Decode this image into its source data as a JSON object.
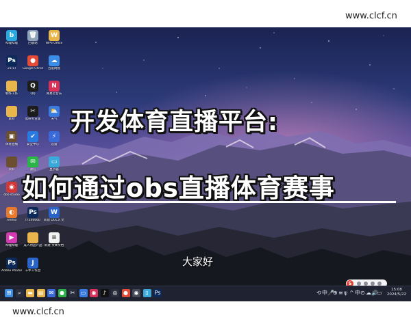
{
  "watermark": {
    "top": "www.clcf.cn",
    "bottom": "www.clcf.cn"
  },
  "overlay": {
    "title_line1": "开发体育直播平台:",
    "title_line2": "如何通过obs直播体育赛事",
    "subtitle": "大家好"
  },
  "desktop_icons": [
    {
      "label": "哔哩哔哩",
      "glyph": "b",
      "color": "#2aa9e0",
      "icon": "bilibili-icon"
    },
    {
      "label": "回收站",
      "glyph": "🗑",
      "color": "#8fa3b8",
      "icon": "recycle-bin-icon"
    },
    {
      "label": "WPS Office",
      "glyph": "W",
      "color": "#e8b64a",
      "icon": "folder-icon"
    },
    {
      "label": "21(1)",
      "glyph": "Ps",
      "color": "#0b2a5a",
      "icon": "photoshop-icon"
    },
    {
      "label": "Google Chrome",
      "glyph": "●",
      "color": "#e04b3a",
      "icon": "chrome-icon"
    },
    {
      "label": "百度网盘",
      "glyph": "☁",
      "color": "#3a8ee8",
      "icon": "cloud-icon"
    },
    {
      "label": "制作工作",
      "glyph": "",
      "color": "#e8b64a",
      "icon": "folder-icon"
    },
    {
      "label": "QQ",
      "glyph": "Q",
      "color": "#1d1d1d",
      "icon": "qq-icon"
    },
    {
      "label": "网易云音乐",
      "glyph": "N",
      "color": "#d8325a",
      "icon": "music-icon"
    },
    {
      "label": "素材",
      "glyph": "",
      "color": "#e8b64a",
      "icon": "folder-icon"
    },
    {
      "label": "剪映专业版",
      "glyph": "✂",
      "color": "#1c1c1c",
      "icon": "capcut-icon"
    },
    {
      "label": "天气",
      "glyph": "⛅",
      "color": "#3a7be0",
      "icon": "weather-icon"
    },
    {
      "label": "体育直播",
      "glyph": "▣",
      "color": "#6a5030",
      "icon": "image-icon"
    },
    {
      "label": "安全中心",
      "glyph": "✔",
      "color": "#2a7ae0",
      "icon": "shield-icon"
    },
    {
      "label": "迅雷",
      "glyph": "⚡",
      "color": "#3a6ad8",
      "icon": "thunder-icon"
    },
    {
      "label": "资料",
      "glyph": "",
      "color": "#6a5030",
      "icon": "folder-icon"
    },
    {
      "label": "微信",
      "glyph": "✉",
      "color": "#2bb34a",
      "icon": "wechat-icon"
    },
    {
      "label": "显示器",
      "glyph": "▭",
      "color": "#3aa8d8",
      "icon": "monitor-icon"
    },
    {
      "label": "obs-studio",
      "glyph": "◉",
      "color": "#d03838",
      "icon": "obs-icon"
    },
    {
      "label": "直播伴侣",
      "glyph": "◎",
      "color": "#e03a3a",
      "icon": "live-icon"
    },
    {
      "label": "抖音",
      "glyph": "♪",
      "color": "#111111",
      "icon": "douyin-icon"
    },
    {
      "label": "Firefox",
      "glyph": "◐",
      "color": "#e8782a",
      "icon": "firefox-icon"
    },
    {
      "label": "f7246660",
      "glyph": "Ps",
      "color": "#0b2a5a",
      "icon": "photoshop-icon"
    },
    {
      "label": "新建 DOCX 文档",
      "glyph": "W",
      "color": "#2a64c8",
      "icon": "word-icon"
    },
    {
      "label": "哔哩哔哩",
      "glyph": "▶",
      "color": "#d43ab0",
      "icon": "video-icon"
    },
    {
      "label": "成人用品产品",
      "glyph": "",
      "color": "#e8b64a",
      "icon": "folder-icon"
    },
    {
      "label": "新建 文本文档",
      "glyph": "≡",
      "color": "#f2f2f2",
      "icon": "text-file-icon"
    },
    {
      "label": "Adobe Photosho...",
      "glyph": "Ps",
      "color": "#0b2a5a",
      "icon": "photoshop-icon"
    },
    {
      "label": "千牛工作台",
      "glyph": "J",
      "color": "#2a64c8",
      "icon": "qianniu-icon"
    }
  ],
  "taskbar": {
    "apps": [
      {
        "name": "start-button",
        "glyph": "⊞",
        "color": "#3b8de0"
      },
      {
        "name": "search-icon",
        "glyph": "⌕",
        "color": "#2a2e3c"
      },
      {
        "name": "file-explorer-icon",
        "glyph": "▬",
        "color": "#e8b64a"
      },
      {
        "name": "file-explorer-icon",
        "glyph": "▤",
        "color": "#e8b64a"
      },
      {
        "name": "mail-icon",
        "glyph": "✉",
        "color": "#3a6ad8"
      },
      {
        "name": "wechat-icon",
        "glyph": "●",
        "color": "#2bb34a"
      },
      {
        "name": "capcut-icon",
        "glyph": "✂",
        "color": "#2a2e3c"
      },
      {
        "name": "app-icon",
        "glyph": "▭",
        "color": "#3a7be0"
      },
      {
        "name": "music-icon",
        "glyph": "◉",
        "color": "#d8325a"
      },
      {
        "name": "douyin-icon",
        "glyph": "♪",
        "color": "#111111"
      },
      {
        "name": "obs-icon",
        "glyph": "◎",
        "color": "#2a2e3c"
      },
      {
        "name": "chrome-icon",
        "glyph": "●",
        "color": "#e04b3a"
      },
      {
        "name": "obs-icon",
        "glyph": "◉",
        "color": "#444a5a"
      },
      {
        "name": "app-icon",
        "glyph": "▯",
        "color": "#3aa8d8"
      },
      {
        "name": "photoshop-icon",
        "glyph": "Ps",
        "color": "#0b2a5a"
      }
    ],
    "tray": [
      "⟲",
      "中",
      "🎤",
      "⊕",
      "≡",
      "ψ",
      "^",
      "中",
      "⊙",
      "☁",
      "🔊",
      "▭"
    ],
    "time": "15:08",
    "date": "2024/5/22"
  }
}
